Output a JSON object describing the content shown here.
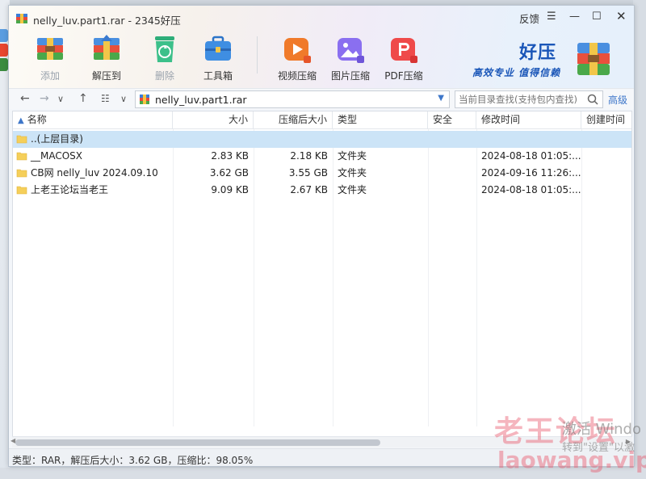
{
  "window": {
    "title": "nelly_luv.part1.rar - 2345好压",
    "controls": {
      "feedback": "反馈",
      "menu": "☰",
      "minimize": "—",
      "maximize": "☐",
      "close": "✕"
    }
  },
  "toolbar": {
    "add": "添加",
    "extract": "解压到",
    "delete": "删除",
    "tools": "工具箱",
    "video": "视频压缩",
    "image": "图片压缩",
    "pdf": "PDF压缩"
  },
  "brand": {
    "name": "好压",
    "slogan": "高效专业 值得信赖"
  },
  "address": {
    "path": "nelly_luv.part1.rar",
    "search_placeholder": "当前目录查找(支持包内查找)",
    "advanced": "高级"
  },
  "columns": [
    "名称",
    "大小",
    "压缩后大小",
    "类型",
    "安全",
    "修改时间",
    "创建时间"
  ],
  "rows": [
    {
      "name": "..(上层目录)",
      "size": "",
      "csize": "",
      "type": "",
      "security": "",
      "mtime": "",
      "ctime": ""
    },
    {
      "name": "__MACOSX",
      "size": "2.83 KB",
      "csize": "2.18 KB",
      "type": "文件夹",
      "security": "",
      "mtime": "2024-08-18 01:05:...",
      "ctime": ""
    },
    {
      "name": "CB网 nelly_luv 2024.09.10",
      "size": "3.62 GB",
      "csize": "3.55 GB",
      "type": "文件夹",
      "security": "",
      "mtime": "2024-09-16 11:26:...",
      "ctime": ""
    },
    {
      "name": "上老王论坛当老王",
      "size": "9.09 KB",
      "csize": "2.67 KB",
      "type": "文件夹",
      "security": "",
      "mtime": "2024-08-18 01:05:...",
      "ctime": ""
    }
  ],
  "status": "类型：RAR，解压后大小：3.62 GB，压缩比：98.05%",
  "watermark": {
    "site": "老王论坛",
    "url": "laowang.vip",
    "activate1": "激活 Windo",
    "activate2": "转到\"设置\"以激"
  }
}
